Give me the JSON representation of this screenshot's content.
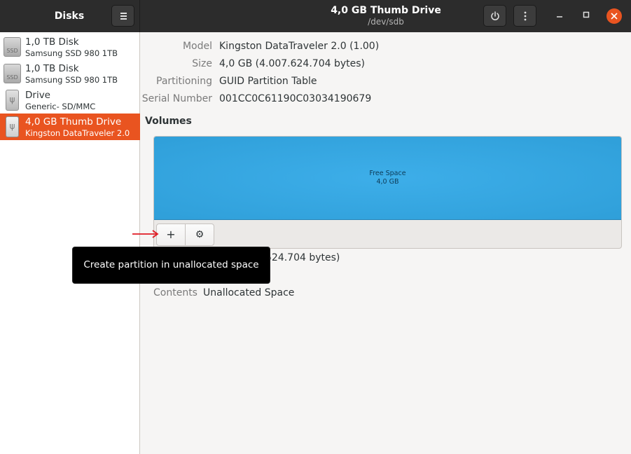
{
  "header": {
    "app_title": "Disks",
    "window_title": "4,0 GB Thumb Drive",
    "window_subtitle": "/dev/sdb",
    "accent_color": "#e95420"
  },
  "sidebar": {
    "items": [
      {
        "name": "1,0 TB Disk",
        "model": "Samsung SSD 980 1TB",
        "icon": "ssd-disk-icon",
        "icon_label": "SSD",
        "selected": false
      },
      {
        "name": "1,0 TB Disk",
        "model": "Samsung SSD 980 1TB",
        "icon": "ssd-disk-icon",
        "icon_label": "SSD",
        "selected": false
      },
      {
        "name": "Drive",
        "model": "Generic- SD/MMC",
        "icon": "usb-drive-icon",
        "selected": false
      },
      {
        "name": "4,0 GB Thumb Drive",
        "model": "Kingston DataTraveler 2.0",
        "icon": "usb-drive-icon",
        "selected": true
      }
    ]
  },
  "drive_properties": {
    "model_label": "Model",
    "model_value": "Kingston DataTraveler 2.0 (1.00)",
    "size_label": "Size",
    "size_value": "4,0 GB (4.007.624.704 bytes)",
    "partitioning_label": "Partitioning",
    "partitioning_value": "GUID Partition Table",
    "serial_label": "Serial Number",
    "serial_value": "001CC0C61190C03034190679"
  },
  "volumes": {
    "heading": "Volumes",
    "segment_name": "Free Space",
    "segment_size": "4,0 GB",
    "segment_color": "#3daee9",
    "add_button_glyph": "+",
    "settings_button_glyph": "⚙"
  },
  "volume_details": {
    "size_partial": "524.704 bytes)",
    "contents_label": "Contents",
    "contents_value": "Unallocated Space"
  },
  "tooltip": {
    "text": "Create partition in unallocated space"
  }
}
